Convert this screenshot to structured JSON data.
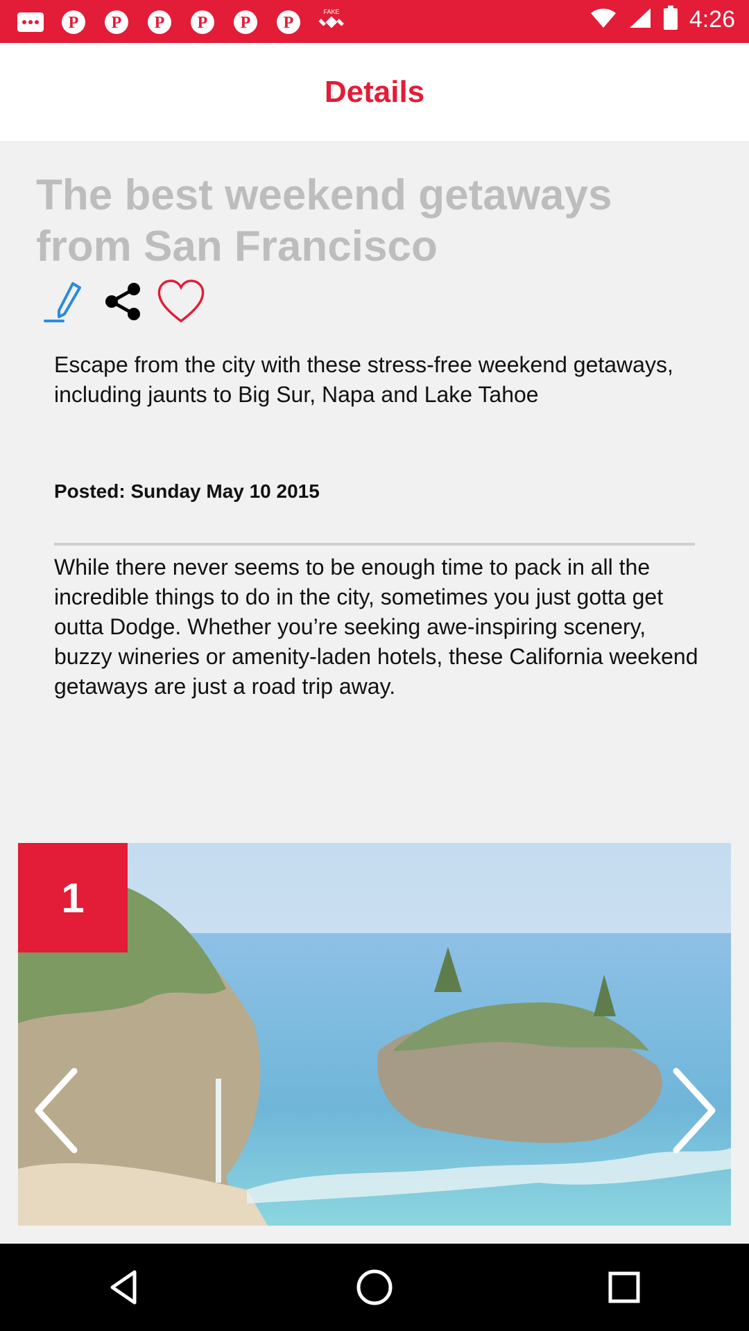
{
  "status_bar": {
    "time": "4:26",
    "left_icons": [
      "message-icon",
      "pinterest-icon",
      "pinterest-icon",
      "pinterest-icon",
      "pinterest-icon",
      "pinterest-icon",
      "pinterest-icon",
      "satellite-icon"
    ],
    "right_icons": [
      "wifi-icon",
      "signal-icon",
      "battery-icon"
    ],
    "fake_label": "FAKE"
  },
  "app_bar": {
    "title": "Details"
  },
  "article": {
    "title": "The best weekend getaways from San Francisco",
    "summary": "Escape from the city with these stress-free weekend getaways, including jaunts to Big Sur, Napa and Lake Tahoe",
    "posted": "Posted: Sunday May 10  2015",
    "body": "While there never seems to be enough time to pack in all the incredible things to do in the city, sometimes you just gotta get outta Dodge. Whether you’re seeking awe-inspiring scenery, buzzy wineries or amenity-laden hotels, these California weekend getaways are just a road trip away."
  },
  "gallery": {
    "index_label": "1",
    "photo_subject": "coastal cove with waterfall and pine-topped cliffs"
  },
  "colors": {
    "accent": "#e31c37",
    "background": "#f1f1f1",
    "title_gray": "#bdbdbd"
  }
}
